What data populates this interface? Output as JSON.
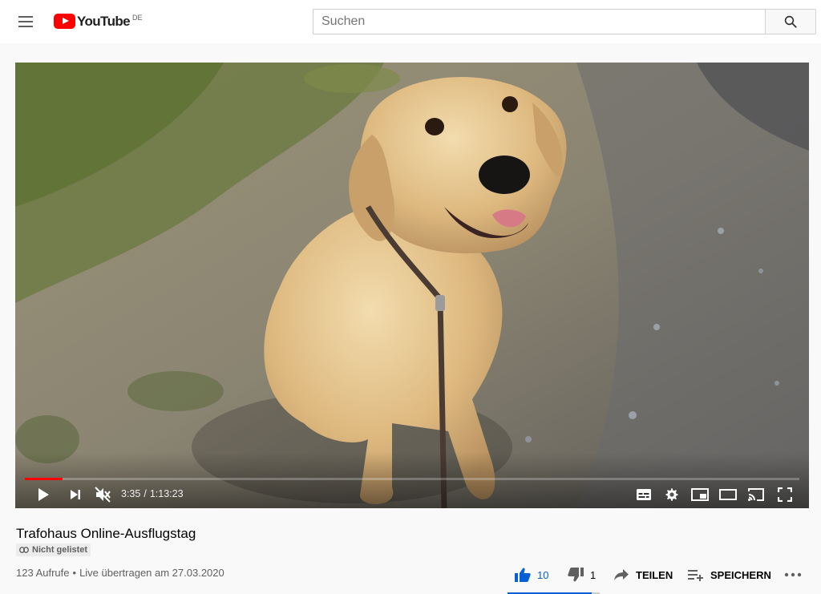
{
  "header": {
    "logo_text": "YouTube",
    "country_code": "DE",
    "search_placeholder": "Suchen"
  },
  "player": {
    "current_time": "3:35",
    "separator": "/",
    "duration": "1:13:23",
    "progress_fraction": 0.049,
    "is_muted": true
  },
  "video": {
    "title": "Trafohaus Online-Ausflugstag",
    "visibility": "Nicht gelistet",
    "views": "123 Aufrufe",
    "dot": "•",
    "date_text": "Live übertragen am 27.03.2020"
  },
  "actions": {
    "like_count": "10",
    "dislike_count": "1",
    "share_label": "TEILEN",
    "save_label": "SPEICHERN",
    "like_ratio": 0.909
  },
  "colors": {
    "brand_red": "#ff0000",
    "like_blue": "#065fd4",
    "text_secondary": "#606060"
  },
  "icons": [
    "menu-icon",
    "youtube-logo-icon",
    "search-icon",
    "play-icon",
    "next-icon",
    "mute-icon",
    "subtitles-icon",
    "settings-gear-icon",
    "miniplayer-icon",
    "theater-mode-icon",
    "cast-icon",
    "fullscreen-icon",
    "link-icon",
    "thumbs-up-icon",
    "thumbs-down-icon",
    "share-icon",
    "playlist-add-icon",
    "more-icon"
  ]
}
